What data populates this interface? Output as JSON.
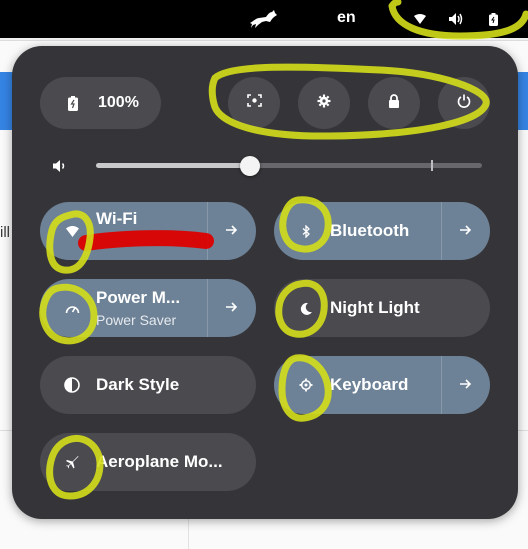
{
  "background": {
    "fragment": "ill"
  },
  "topbar": {
    "logo_icon": "cat-icon",
    "language": "en",
    "indicators": [
      "wifi-icon",
      "volume-icon",
      "battery-icon"
    ]
  },
  "panel": {
    "battery": {
      "icon": "battery-icon",
      "label": "100%"
    },
    "actions": [
      {
        "name": "screenshot-icon"
      },
      {
        "name": "settings-icon"
      },
      {
        "name": "lock-icon"
      },
      {
        "name": "power-icon"
      }
    ],
    "volume": {
      "icon": "volume-icon",
      "level": 0.4
    },
    "toggles": [
      {
        "id": "wifi",
        "title": "Wi-Fi",
        "subtitle": "",
        "state": "on",
        "icon": "wifi-icon",
        "has_menu": true
      },
      {
        "id": "bluetooth",
        "title": "Bluetooth",
        "subtitle": "",
        "state": "on",
        "icon": "bluetooth-icon",
        "has_menu": true
      },
      {
        "id": "power-mode",
        "title": "Power M...",
        "subtitle": "Power Saver",
        "state": "on",
        "icon": "power-mode-icon",
        "has_menu": true
      },
      {
        "id": "night-light",
        "title": "Night Light",
        "subtitle": "",
        "state": "off",
        "icon": "moon-icon",
        "has_menu": false
      },
      {
        "id": "dark-style",
        "title": "Dark Style",
        "subtitle": "",
        "state": "off",
        "icon": "dark-style-icon",
        "has_menu": false
      },
      {
        "id": "keyboard",
        "title": "Keyboard",
        "subtitle": "",
        "state": "on",
        "icon": "gear-icon",
        "has_menu": true
      },
      {
        "id": "aeroplane",
        "title": "Aeroplane Mo...",
        "subtitle": "",
        "state": "off",
        "icon": "aeroplane-icon",
        "has_menu": false
      }
    ]
  },
  "colors": {
    "panel": "#353539",
    "tile_on": "#6d8296",
    "tile_off": "#4a4a4f",
    "highlight": "#d4de1a",
    "redaction": "#dd0000"
  }
}
